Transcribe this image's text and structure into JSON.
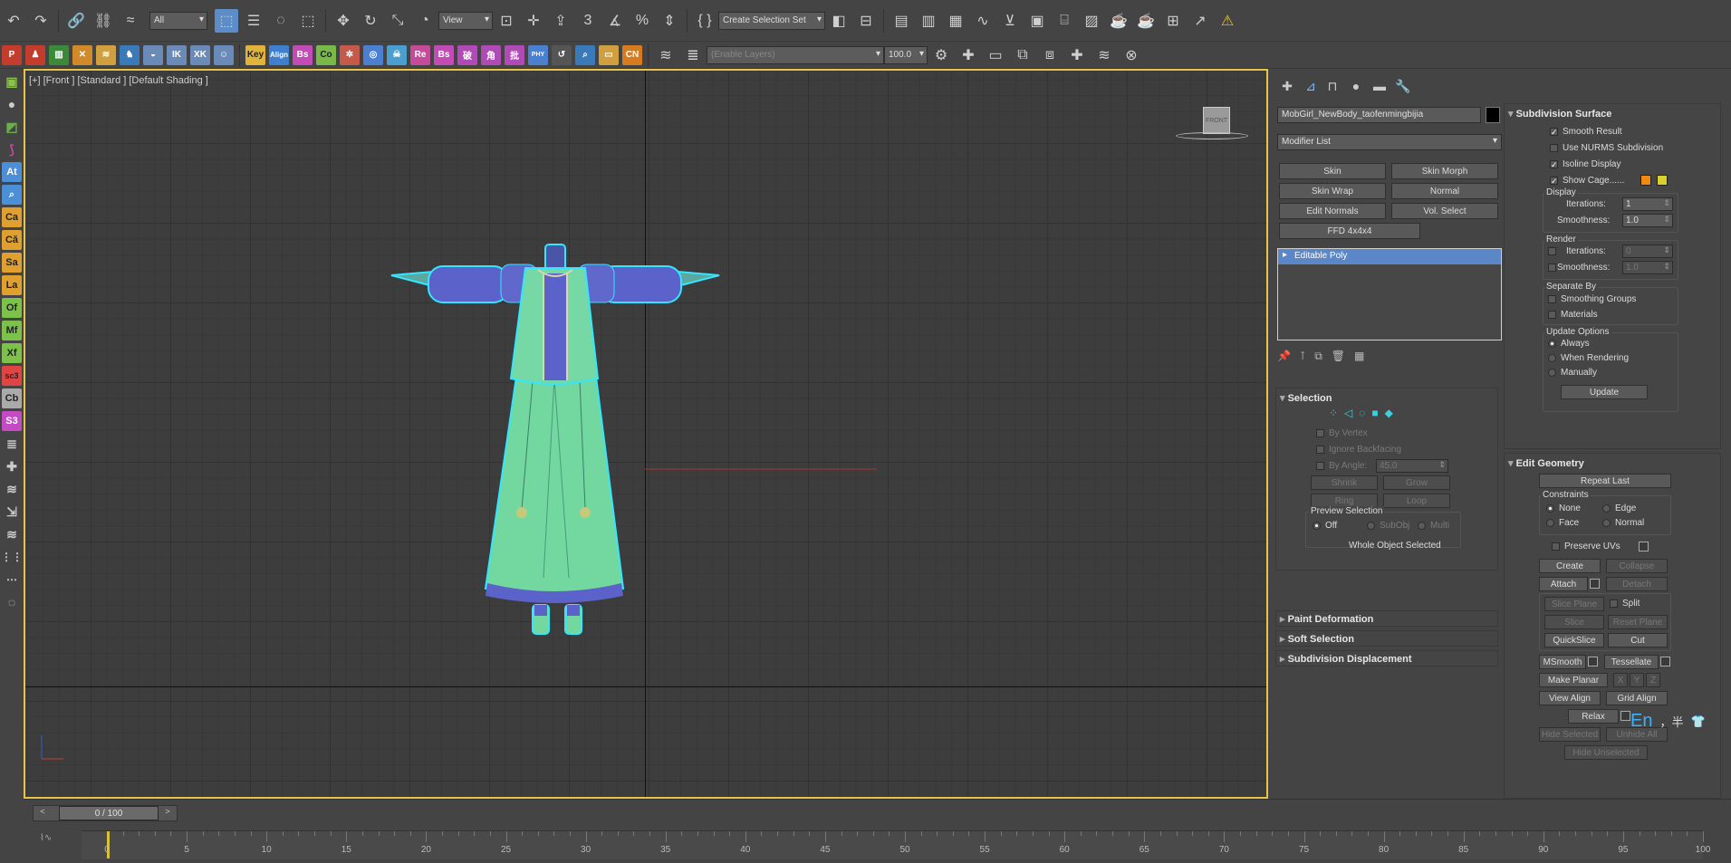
{
  "toolbar1": {
    "selection_filter": "All",
    "ref_coord": "View",
    "named_selection": "Create Selection Set"
  },
  "toolbar2": {
    "plugins": [
      {
        "label": "Key",
        "color": "#e0b33a"
      },
      {
        "label": "Align",
        "color": "#3f7fd0"
      },
      {
        "label": "Bs",
        "color": "#c24bb5"
      },
      {
        "label": "Co",
        "color": "#79b94a"
      },
      {
        "label": "Re",
        "color": "#c44b9a"
      },
      {
        "label": "Bs",
        "color": "#c24bb5"
      },
      {
        "label": "破",
        "color": "#b04bb5"
      },
      {
        "label": "角",
        "color": "#b04bb5"
      },
      {
        "label": "批",
        "color": "#b04bb5"
      },
      {
        "label": "CN",
        "color": "#d87a1f"
      }
    ],
    "layer_dropdown": "(Enable Layers)",
    "layer_value": "100.0"
  },
  "left_tools": [
    {
      "label": "At",
      "color": "#4b8fd8"
    },
    {
      "label": "Ca",
      "color": "#e0a030"
    },
    {
      "label": "Că",
      "color": "#e0a030"
    },
    {
      "label": "Sa",
      "color": "#e0a030"
    },
    {
      "label": "La",
      "color": "#e0a030"
    },
    {
      "label": "Of",
      "color": "#7cc24a"
    },
    {
      "label": "Mf",
      "color": "#7cc24a"
    },
    {
      "label": "Xf",
      "color": "#7cc24a"
    },
    {
      "label": "sc3",
      "color": "#e04545"
    },
    {
      "label": "Cb",
      "color": "#aaaaaa"
    },
    {
      "label": "S3",
      "color": "#c44bc4"
    }
  ],
  "viewport": {
    "label": "[+] [Front ] [Standard ] [Default Shading ]",
    "viewcube_label": "FRONT"
  },
  "command_panel": {
    "object_name": "MobGirl_NewBody_taofenmingbijia",
    "modifier_list": "Modifier List",
    "modifier_buttons": [
      "Skin",
      "Skin Morph",
      "Skin Wrap",
      "Normal",
      "Edit Normals",
      "Vol. Select",
      "FFD 4x4x4"
    ],
    "stack_item": "Editable Poly",
    "selection": {
      "title": "Selection",
      "by_vertex": "By Vertex",
      "ignore_backfacing": "Ignore Backfacing",
      "by_angle": "By Angle:",
      "angle_value": "45.0",
      "shrink": "Shrink",
      "grow": "Grow",
      "ring": "Ring",
      "loop": "Loop",
      "preview_selection": "Preview Selection",
      "off": "Off",
      "subobj": "SubObj",
      "multi": "Multi",
      "status": "Whole Object Selected"
    },
    "closed_rollouts": [
      "Paint Deformation",
      "Soft Selection",
      "Subdivision Displacement"
    ]
  },
  "subdivision": {
    "title": "Subdivision Surface",
    "smooth_result": "Smooth Result",
    "use_nurms": "Use NURMS Subdivision",
    "isoline": "Isoline Display",
    "show_cage": "Show Cage......",
    "cage_color1": "#f08a12",
    "cage_color2": "#d8d02e",
    "display": "Display",
    "iterations_label": "Iterations:",
    "display_iterations": "1",
    "smoothness_label": "Smoothness:",
    "display_smoothness": "1.0",
    "render": "Render",
    "render_iterations": "0",
    "render_smoothness": "1.0",
    "separate_by": "Separate By",
    "smoothing_groups": "Smoothing Groups",
    "materials": "Materials",
    "update_options": "Update Options",
    "always": "Always",
    "when_rendering": "When Rendering",
    "manually": "Manually",
    "update": "Update"
  },
  "edit_geometry": {
    "title": "Edit Geometry",
    "repeat_last": "Repeat Last",
    "constraints": "Constraints",
    "none": "None",
    "edge": "Edge",
    "face": "Face",
    "normal": "Normal",
    "preserve_uvs": "Preserve UVs",
    "create": "Create",
    "collapse": "Collapse",
    "attach": "Attach",
    "detach": "Detach",
    "slice_plane": "Slice Plane",
    "split": "Split",
    "slice": "Slice",
    "reset_plane": "Reset Plane",
    "quickslice": "QuickSlice",
    "cut": "Cut",
    "msmooth": "MSmooth",
    "tessellate": "Tessellate",
    "make_planar": "Make Planar",
    "x": "X",
    "y": "Y",
    "z": "Z",
    "view_align": "View Align",
    "grid_align": "Grid Align",
    "relax": "Relax",
    "hide_selected": "Hide Selected",
    "unhide_all": "Unhide All",
    "hide_unselected": "Hide Unselected"
  },
  "timeline": {
    "frame_display": "0 / 100",
    "ticks": [
      "0",
      "5",
      "10",
      "15",
      "20",
      "25",
      "30",
      "35",
      "40",
      "45",
      "50",
      "55",
      "60",
      "65",
      "70",
      "75",
      "80",
      "85",
      "90",
      "95",
      "100"
    ]
  },
  "ime": {
    "lang": "En",
    "symbols": "，半"
  }
}
